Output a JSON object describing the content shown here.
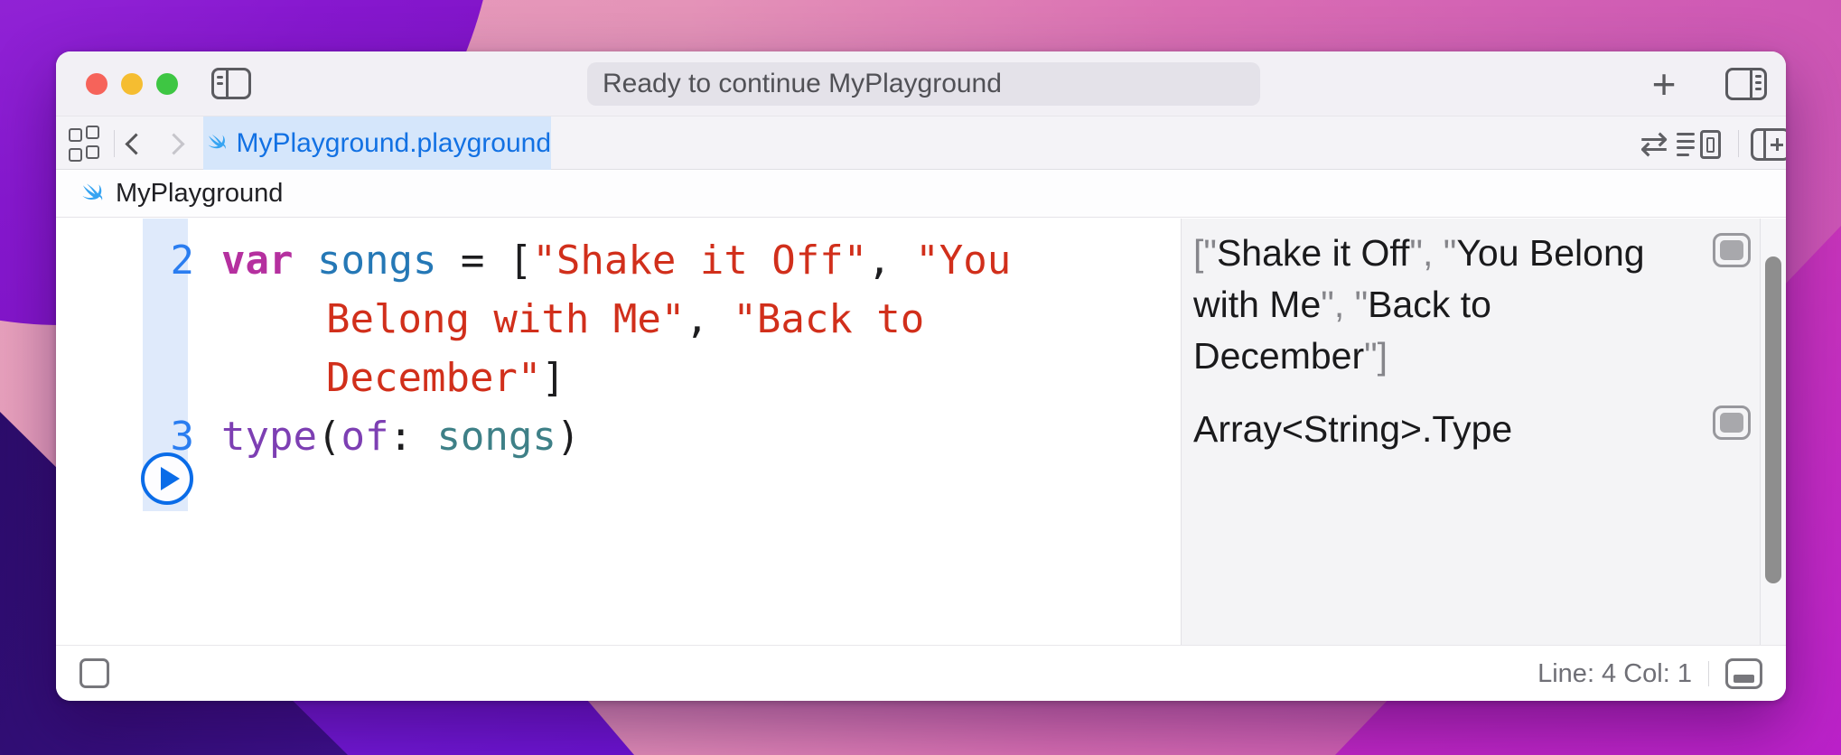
{
  "titlebar": {
    "status_text": "Ready to continue MyPlayground",
    "plus_icon": "+"
  },
  "tabbar": {
    "active_tab_label": "MyPlayground.playground",
    "swap_icon": "⇄"
  },
  "breadcrumb": {
    "file_name": "MyPlayground"
  },
  "editor": {
    "rows": [
      {
        "num": "2",
        "segments": [
          {
            "t": "var",
            "c": "keyword"
          },
          {
            "t": " ",
            "c": "plain"
          },
          {
            "t": "songs",
            "c": "decl"
          },
          {
            "t": " = [",
            "c": "plain"
          },
          {
            "t": "\"Shake it Off\"",
            "c": "string"
          },
          {
            "t": ", ",
            "c": "plain"
          },
          {
            "t": "\"You",
            "c": "string"
          }
        ]
      },
      {
        "num": "",
        "segments": [
          {
            "t": "Belong with Me\"",
            "c": "string"
          },
          {
            "t": ", ",
            "c": "plain"
          },
          {
            "t": "\"Back to",
            "c": "string"
          }
        ]
      },
      {
        "num": "",
        "segments": [
          {
            "t": "December\"",
            "c": "string"
          },
          {
            "t": "]",
            "c": "plain"
          }
        ]
      },
      {
        "num": "3",
        "segments": [
          {
            "t": "type",
            "c": "func"
          },
          {
            "t": "(",
            "c": "plain"
          },
          {
            "t": "of",
            "c": "func"
          },
          {
            "t": ": ",
            "c": "plain"
          },
          {
            "t": "songs",
            "c": "varuse"
          },
          {
            "t": ")",
            "c": "plain"
          }
        ]
      }
    ]
  },
  "results": {
    "items": [
      {
        "lines": [
          [
            {
              "t": "[\"",
              "c": "gray"
            },
            {
              "t": "Shake it Off",
              "c": "black"
            },
            {
              "t": "\", \"",
              "c": "gray"
            },
            {
              "t": "You Belong",
              "c": "black"
            }
          ],
          [
            {
              "t": "with Me",
              "c": "black"
            },
            {
              "t": "\", \"",
              "c": "gray"
            },
            {
              "t": "Back to",
              "c": "black"
            }
          ],
          [
            {
              "t": "December",
              "c": "black"
            },
            {
              "t": "\"]",
              "c": "gray"
            }
          ]
        ]
      },
      {
        "lines": [
          [
            {
              "t": "Array<String>.Type",
              "c": "black"
            }
          ]
        ]
      }
    ]
  },
  "statusbar": {
    "line_col": "Line: 4  Col: 1"
  },
  "colors": {
    "accent_blue": "#1271E3",
    "line_number_blue": "#2A7DF0",
    "keyword_pink": "#B5309F",
    "declaration_blue": "#2578B6",
    "string_red": "#D12F1B",
    "function_purple": "#7D3FB3",
    "variable_teal": "#3E8087",
    "tab_active_bg": "#D5E6FB",
    "gutter_highlight": "#DFEAFB",
    "results_bg": "#F4F4F6",
    "result_gray": "#85858A",
    "play_button_blue": "#0A6CE8",
    "traffic_red": "#F6635A",
    "traffic_yellow": "#F5BD31",
    "traffic_green": "#3EC643",
    "swift_icon_blue": "#36A4F2"
  }
}
